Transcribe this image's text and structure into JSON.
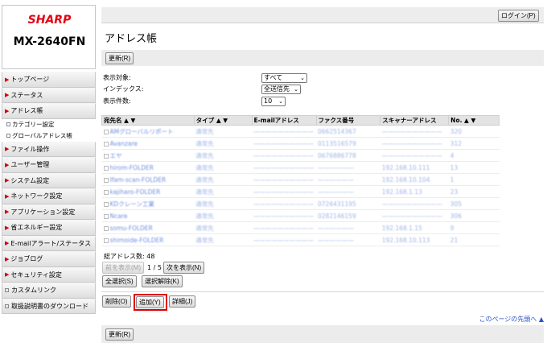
{
  "brand": {
    "logo": "SHARP",
    "model": "MX-2640FN"
  },
  "login_label": "ログイン(P)",
  "page_title": "アドレス帳",
  "refresh_label": "更新(R)",
  "nav": [
    {
      "label": "トップページ",
      "type": "main"
    },
    {
      "label": "ステータス",
      "type": "main"
    },
    {
      "label": "アドレス帳",
      "type": "main"
    },
    {
      "label": "カテゴリー設定",
      "type": "sub"
    },
    {
      "label": "グローバルアドレス帳",
      "type": "sub"
    },
    {
      "label": "ファイル操作",
      "type": "main"
    },
    {
      "label": "ユーザー管理",
      "type": "main"
    },
    {
      "label": "システム設定",
      "type": "main"
    },
    {
      "label": "ネットワーク設定",
      "type": "main"
    },
    {
      "label": "アプリケーション設定",
      "type": "main"
    },
    {
      "label": "省エネルギー設定",
      "type": "main"
    },
    {
      "label": "E-mailアラート/ステータス",
      "type": "main"
    },
    {
      "label": "ジョブログ",
      "type": "main"
    },
    {
      "label": "セキュリティ設定",
      "type": "main"
    },
    {
      "label": "カスタムリンク",
      "type": "box"
    },
    {
      "label": "取扱説明書のダウンロード",
      "type": "box"
    }
  ],
  "filters": {
    "target_label": "表示対象:",
    "target_value": "すべて",
    "index_label": "インデックス:",
    "index_value": "全送信先",
    "count_label": "表示件数:",
    "count_value": "10"
  },
  "table": {
    "headers": [
      "宛先名 ▲ ▼",
      "タイプ ▲ ▼",
      "E-mailアドレス",
      "ファクス番号",
      "スキャナーアドレス",
      "No. ▲ ▼"
    ],
    "rows": [
      [
        "AMグローバルリポート",
        "通常先",
        "——————————",
        "0662514367",
        "——————————",
        "320"
      ],
      [
        "Avanzare",
        "通常先",
        "——————————",
        "0113516579",
        "——————————",
        "312"
      ],
      [
        "エヤ",
        "通常先",
        "——————————",
        "0676886778",
        "——————————",
        "4"
      ],
      [
        "hirom-FOLDER",
        "通常先",
        "——————————",
        "——————",
        "192.168.10.111",
        "13"
      ],
      [
        "Ifam-scan-FOLDER",
        "通常先",
        "——————————",
        "——————",
        "192.168.10.104",
        "1"
      ],
      [
        "kajiharo-FOLDER",
        "通常先",
        "——————————",
        "——————",
        "192.168.1.13",
        "23"
      ],
      [
        "KDクレーン工業",
        "通常先",
        "——————————",
        "0726431195",
        "——————————",
        "305"
      ],
      [
        "Ncare",
        "通常先",
        "——————————",
        "0282146159",
        "——————————",
        "306"
      ],
      [
        "somu-FOLDER",
        "通常先",
        "——————————",
        "——————",
        "192.168.1.15",
        "9"
      ],
      [
        "shimoide-FOLDER",
        "通常先",
        "——————————",
        "——————",
        "192.168.10.113",
        "21"
      ]
    ]
  },
  "total_label": "総アドレス数:  48",
  "prev_label": "前を表示(M)",
  "page_indicator": "1 / 5",
  "next_label": "次を表示(N)",
  "select_all_label": "全選択(S)",
  "deselect_label": "選択解除(K)",
  "delete_label": "削除(O)",
  "add_label": "追加(Y)",
  "detail_label": "詳細(J)",
  "page_top_label": "このページの先頭へ ▲",
  "colors": {
    "brand_red": "#e60012",
    "highlight": "#e00000",
    "link": "#2a55c9"
  }
}
